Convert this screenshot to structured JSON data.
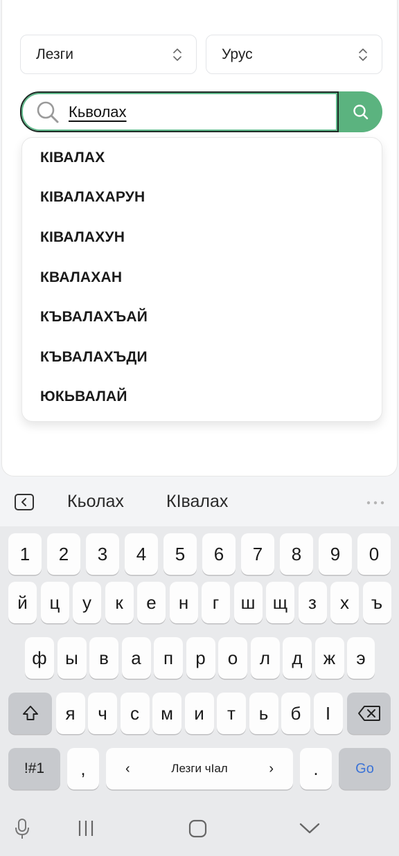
{
  "selectors": {
    "source_language": "Лезги",
    "target_language": "Урус"
  },
  "search": {
    "query": "Кьволах"
  },
  "suggestions": [
    "КІВАЛАХ",
    "КІВАЛАХАРУН",
    "КІВАЛАХУН",
    "КВАЛАХАН",
    "КЪВАЛАХЪАЙ",
    "КЪВАЛАХЪДИ",
    "ЮКЬВАЛАЙ"
  ],
  "keyboard": {
    "predictions": [
      "Кьолах",
      "КІвалах"
    ],
    "row_numbers": [
      "1",
      "2",
      "3",
      "4",
      "5",
      "6",
      "7",
      "8",
      "9",
      "0"
    ],
    "row1": [
      "й",
      "ц",
      "у",
      "к",
      "е",
      "н",
      "г",
      "ш",
      "щ",
      "з",
      "х",
      "ъ"
    ],
    "row2": [
      "ф",
      "ы",
      "в",
      "а",
      "п",
      "р",
      "о",
      "л",
      "д",
      "ж",
      "э"
    ],
    "row3": [
      "я",
      "ч",
      "с",
      "м",
      "и",
      "т",
      "ь",
      "б",
      "І"
    ],
    "symbols_label": "!#1",
    "comma_label": ",",
    "space_label": "Лезги чІал",
    "space_left_arrow": "‹",
    "space_right_arrow": "›",
    "period_label": ".",
    "go_label": "Go"
  },
  "colors": {
    "accent_green": "#5bb37f",
    "go_blue": "#3c73d6"
  }
}
